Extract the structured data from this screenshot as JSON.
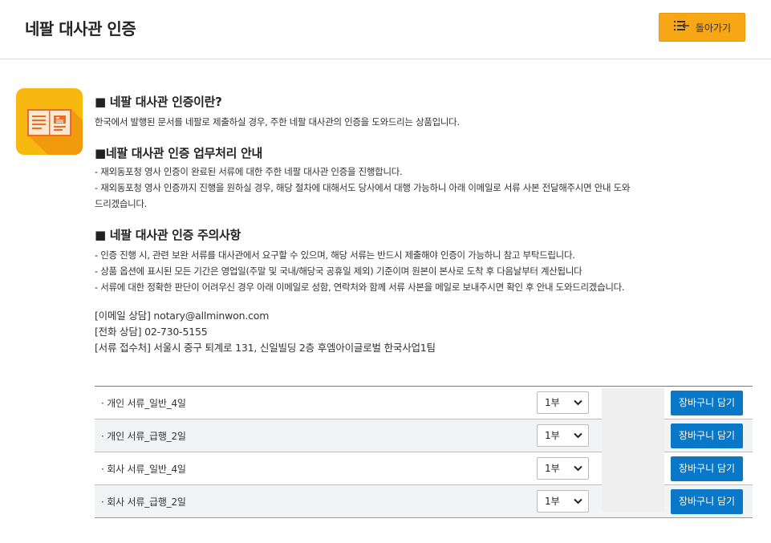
{
  "header": {
    "title": "네팔 대사관 인증",
    "back_label": "돌아가기"
  },
  "sections": [
    {
      "title": "■ 네팔 대사관 인증이란?",
      "lines": [
        "한국에서 발행된 문서를 네팔로 제출하실 경우, 주한 네팔 대사관의 인증을 도와드리는 상품입니다."
      ]
    },
    {
      "title": "■네팔 대사관 인증 업무처리 안내",
      "lines": [
        "- 재외동포청 영사 인증이 완료된 서류에 대한 주한 네팔 대사관 인증을 진행합니다.",
        "- 재외동포청 영사 인증까지 진행을 원하실 경우, 해당 절차에 대해서도 당사에서 대행 가능하니 아래 이메일로 서류 사본 전달해주시면 안내 도와",
        "드리겠습니다."
      ]
    },
    {
      "title": "■ 네팔 대사관 인증 주의사항",
      "lines": [
        "- 인증 진행 시, 관련 보완 서류를 대사관에서 요구할 수 있으며, 해당 서류는 반드시 제출해야 인증이 가능하니 참고 부탁드립니다.",
        "- 상품 옵션에 표시된 모든 기간은 영업일(주말 및 국내/해당국 공휴일 제외) 기준이며 원본이 본사로 도착 후 다음날부터 계산됩니다",
        "- 서류에 대한 정확한 판단이 어려우신 경우 아래 이메일로 성함, 연락처와 함께 서류 사본을 메일로 보내주시면 확인 후 안내 도와드리겠습니다."
      ]
    }
  ],
  "contact": {
    "email": "[이메일 상담] notary@allminwon.com",
    "phone": "[전화 상담] 02-730-5155",
    "address": "[서류 접수처] 서울시 중구 퇴계로 131, 신일빌딩 2층 후엠아이글로벌 한국사업1팀"
  },
  "products": [
    {
      "name": "· 개인 서류_일반_4일",
      "qty": "1부",
      "cart_label": "장바구니 담기"
    },
    {
      "name": "· 개인 서류_급행_2일",
      "qty": "1부",
      "cart_label": "장바구니 담기"
    },
    {
      "name": "· 회사 서류_일반_4일",
      "qty": "1부",
      "cart_label": "장바구니 담기"
    },
    {
      "name": "· 회사 서류_급행_2일",
      "qty": "1부",
      "cart_label": "장바구니 담기"
    }
  ],
  "colors": {
    "back_button": "#f7a616",
    "cart_button": "#0a78c8",
    "icon_bg": "#f7b80f"
  }
}
